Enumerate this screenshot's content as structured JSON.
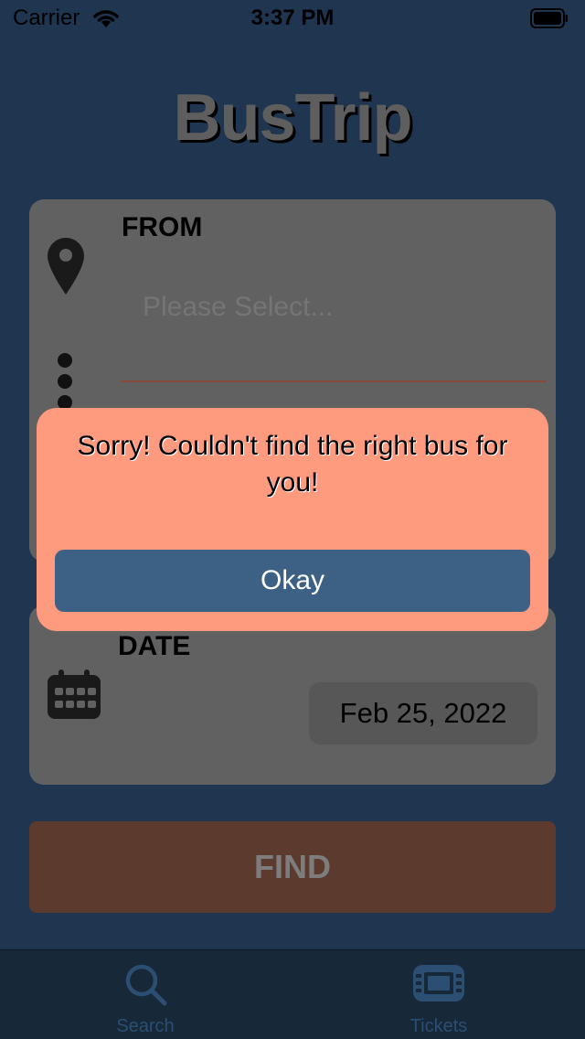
{
  "status_bar": {
    "carrier": "Carrier",
    "time": "3:37 PM",
    "wifi_icon": "wifi-icon",
    "battery_icon": "battery-icon"
  },
  "app": {
    "title": "BusTrip"
  },
  "from_card": {
    "label": "FROM",
    "icon": "map-pin-icon",
    "input_placeholder": "Please Select..."
  },
  "date_card": {
    "label": "DATE",
    "icon": "calendar-icon",
    "value": "Feb 25, 2022"
  },
  "find_button": {
    "label": "FIND"
  },
  "tab_bar": {
    "tabs": [
      {
        "label": "Search",
        "icon": "search-icon"
      },
      {
        "label": "Tickets",
        "icon": "ticket-icon"
      }
    ]
  },
  "alert": {
    "message": "Sorry! Couldn't find the right bus for you!",
    "button_label": "Okay"
  },
  "colors": {
    "background": "#1f3550",
    "card": "#616161",
    "alert_background": "#fe9a7e",
    "alert_button": "#3d6184",
    "find_button": "#5c3a2e"
  }
}
